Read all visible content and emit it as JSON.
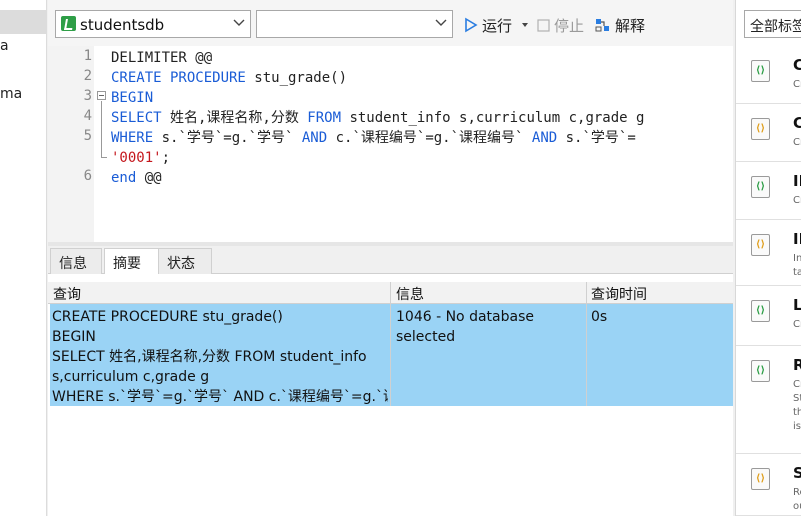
{
  "left_panel": {
    "items": [
      "a",
      "ma"
    ]
  },
  "toolbar": {
    "database_select": "studentsdb",
    "schema_select": "",
    "run_label": "运行",
    "stop_label": "停止",
    "explain_label": "解释"
  },
  "editor": {
    "line_numbers": [
      "1",
      "2",
      "3",
      "4",
      "5",
      "",
      "6"
    ],
    "lines": [
      [
        {
          "t": "DELIMITER @@",
          "c": ""
        }
      ],
      [
        {
          "t": "CREATE PROCEDURE",
          "c": "kw"
        },
        {
          "t": " stu_grade()",
          "c": ""
        }
      ],
      [
        {
          "t": "BEGIN",
          "c": "kw"
        }
      ],
      [
        {
          "t": "SELECT",
          "c": "kw"
        },
        {
          "t": " 姓名,课程名称,分数 ",
          "c": ""
        },
        {
          "t": "FROM",
          "c": "kw"
        },
        {
          "t": " student_info s,curriculum c,grade g",
          "c": ""
        }
      ],
      [
        {
          "t": "WHERE",
          "c": "kw"
        },
        {
          "t": " s.`学号`=g.`学号` ",
          "c": ""
        },
        {
          "t": "AND",
          "c": "kw"
        },
        {
          "t": " c.`课程编号`=g.`课程编号` ",
          "c": ""
        },
        {
          "t": "AND",
          "c": "kw"
        },
        {
          "t": " s.`学号`=",
          "c": ""
        }
      ],
      [
        {
          "t": "'0001'",
          "c": "str"
        },
        {
          "t": ";",
          "c": ""
        }
      ],
      [
        {
          "t": "end",
          "c": "kw"
        },
        {
          "t": " @@",
          "c": ""
        }
      ]
    ]
  },
  "tabs": [
    "信息",
    "摘要",
    "状态"
  ],
  "result": {
    "columns": [
      "查询",
      "信息",
      "查询时间"
    ],
    "row": {
      "query_lines": [
        "CREATE PROCEDURE stu_grade()",
        "BEGIN",
        "SELECT 姓名,课程名称,分数 FROM student_info",
        "s,curriculum c,grade g",
        "WHERE s.`学号`=g.`学号` AND c.`课程编号`=g.`课"
      ],
      "info_lines": [
        "1046 - No database",
        "selected"
      ],
      "time": "0s"
    }
  },
  "right_panel": {
    "filter_label": "全部标签",
    "snippets": [
      {
        "title": "C",
        "desc": [
          "Cr"
        ],
        "icon_color": "green"
      },
      {
        "title": "C",
        "desc": [
          "Cr"
        ],
        "icon_color": "orange"
      },
      {
        "title": "II",
        "desc": [
          "Cr"
        ],
        "icon_color": "green"
      },
      {
        "title": "II",
        "desc": [
          "In",
          "ta"
        ],
        "icon_color": "orange"
      },
      {
        "title": "L",
        "desc": [
          "Cr"
        ],
        "icon_color": "green"
      },
      {
        "title": "R",
        "desc": [
          "Cr",
          "St",
          "th",
          "is"
        ],
        "icon_color": "green"
      },
      {
        "title": "S",
        "desc": [
          "Re",
          "ou"
        ],
        "icon_color": "orange"
      }
    ]
  }
}
